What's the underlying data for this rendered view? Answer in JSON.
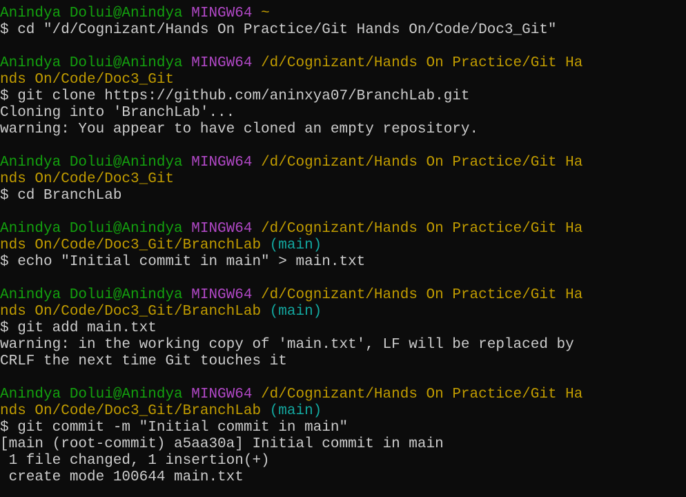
{
  "colors": {
    "green": "#13a10e",
    "purple": "#b148c6",
    "yellow": "#c19c00",
    "cyan": "#13a8a0",
    "white": "#cccccc",
    "background": "#0c0c0c"
  },
  "terminal": {
    "lines": [
      [
        {
          "t": "Anindya Dolui@Anindya ",
          "c": "green"
        },
        {
          "t": "MINGW64 ",
          "c": "purple"
        },
        {
          "t": "~",
          "c": "yellow"
        }
      ],
      [
        {
          "t": "$ cd \"/d/Cognizant/Hands On Practice/Git Hands On/Code/Doc3_Git\"",
          "c": "white"
        }
      ],
      [],
      [
        {
          "t": "Anindya Dolui@Anindya ",
          "c": "green"
        },
        {
          "t": "MINGW64 ",
          "c": "purple"
        },
        {
          "t": "/d/Cognizant/Hands On Practice/Git Ha",
          "c": "yellow"
        }
      ],
      [
        {
          "t": "nds On/Code/Doc3_Git",
          "c": "yellow"
        }
      ],
      [
        {
          "t": "$ git clone https://github.com/aninxya07/BranchLab.git",
          "c": "white"
        }
      ],
      [
        {
          "t": "Cloning into 'BranchLab'...",
          "c": "white"
        }
      ],
      [
        {
          "t": "warning: You appear to have cloned an empty repository.",
          "c": "white"
        }
      ],
      [],
      [
        {
          "t": "Anindya Dolui@Anindya ",
          "c": "green"
        },
        {
          "t": "MINGW64 ",
          "c": "purple"
        },
        {
          "t": "/d/Cognizant/Hands On Practice/Git Ha",
          "c": "yellow"
        }
      ],
      [
        {
          "t": "nds On/Code/Doc3_Git",
          "c": "yellow"
        }
      ],
      [
        {
          "t": "$ cd BranchLab",
          "c": "white"
        }
      ],
      [],
      [
        {
          "t": "Anindya Dolui@Anindya ",
          "c": "green"
        },
        {
          "t": "MINGW64 ",
          "c": "purple"
        },
        {
          "t": "/d/Cognizant/Hands On Practice/Git Ha",
          "c": "yellow"
        }
      ],
      [
        {
          "t": "nds On/Code/Doc3_Git/BranchLab ",
          "c": "yellow"
        },
        {
          "t": "(main)",
          "c": "cyan"
        }
      ],
      [
        {
          "t": "$ echo \"Initial commit in main\" > main.txt",
          "c": "white"
        }
      ],
      [],
      [
        {
          "t": "Anindya Dolui@Anindya ",
          "c": "green"
        },
        {
          "t": "MINGW64 ",
          "c": "purple"
        },
        {
          "t": "/d/Cognizant/Hands On Practice/Git Ha",
          "c": "yellow"
        }
      ],
      [
        {
          "t": "nds On/Code/Doc3_Git/BranchLab ",
          "c": "yellow"
        },
        {
          "t": "(main)",
          "c": "cyan"
        }
      ],
      [
        {
          "t": "$ git add main.txt",
          "c": "white"
        }
      ],
      [
        {
          "t": "warning: in the working copy of 'main.txt', LF will be replaced by",
          "c": "white"
        }
      ],
      [
        {
          "t": "CRLF the next time Git touches it",
          "c": "white"
        }
      ],
      [],
      [
        {
          "t": "Anindya Dolui@Anindya ",
          "c": "green"
        },
        {
          "t": "MINGW64 ",
          "c": "purple"
        },
        {
          "t": "/d/Cognizant/Hands On Practice/Git Ha",
          "c": "yellow"
        }
      ],
      [
        {
          "t": "nds On/Code/Doc3_Git/BranchLab ",
          "c": "yellow"
        },
        {
          "t": "(main)",
          "c": "cyan"
        }
      ],
      [
        {
          "t": "$ git commit -m \"Initial commit in main\"",
          "c": "white"
        }
      ],
      [
        {
          "t": "[main (root-commit) a5aa30a] Initial commit in main",
          "c": "white"
        }
      ],
      [
        {
          "t": " 1 file changed, 1 insertion(+)",
          "c": "white"
        }
      ],
      [
        {
          "t": " create mode 100644 main.txt",
          "c": "white"
        }
      ]
    ]
  }
}
